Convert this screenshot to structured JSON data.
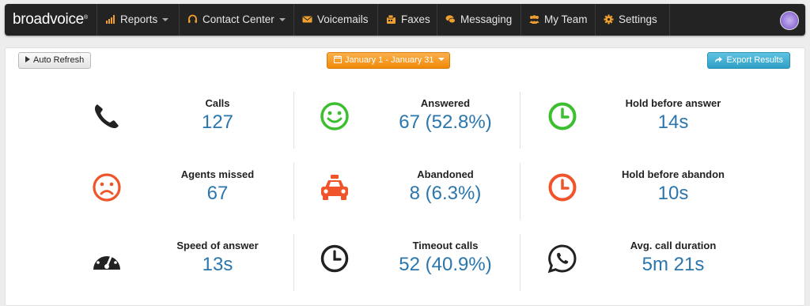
{
  "nav": {
    "brand": "broadvoice",
    "brand_mark": "®",
    "items": [
      {
        "label": "Reports",
        "icon": "bar-chart-icon",
        "dropdown": true
      },
      {
        "label": "Contact Center",
        "icon": "headset-icon",
        "dropdown": true
      },
      {
        "label": "Voicemails",
        "icon": "envelope-icon",
        "dropdown": false
      },
      {
        "label": "Faxes",
        "icon": "fax-icon",
        "dropdown": false
      },
      {
        "label": "Messaging",
        "icon": "chat-icon",
        "dropdown": false
      },
      {
        "label": "My Team",
        "icon": "team-icon",
        "dropdown": false
      },
      {
        "label": "Settings",
        "icon": "gear-icon",
        "dropdown": false
      }
    ],
    "accent": "#f0a02e"
  },
  "toolbar": {
    "auto_refresh": "Auto Refresh",
    "date_range": "January 1 - January 31",
    "export": "Export Results"
  },
  "stats": [
    {
      "label": "Calls",
      "value": "127",
      "icon": "phone-icon",
      "color": "#222222"
    },
    {
      "label": "Answered",
      "value": "67 (52.8%)",
      "icon": "smiley-icon",
      "color": "#3cbf2e"
    },
    {
      "label": "Hold before answer",
      "value": "14s",
      "icon": "clock-green-icon",
      "color": "#3cbf2e"
    },
    {
      "label": "Agents missed",
      "value": "67",
      "icon": "sad-face-icon",
      "color": "#f0542b"
    },
    {
      "label": "Abandoned",
      "value": "8 (6.3%)",
      "icon": "taxi-icon",
      "color": "#f0542b"
    },
    {
      "label": "Hold before abandon",
      "value": "10s",
      "icon": "clock-red-icon",
      "color": "#f0542b"
    },
    {
      "label": "Speed of answer",
      "value": "13s",
      "icon": "speedometer-icon",
      "color": "#222222"
    },
    {
      "label": "Timeout calls",
      "value": "52 (40.9%)",
      "icon": "clock-dark-icon",
      "color": "#222222"
    },
    {
      "label": "Avg. call duration",
      "value": "5m 21s",
      "icon": "whatsapp-icon",
      "color": "#222222"
    }
  ]
}
